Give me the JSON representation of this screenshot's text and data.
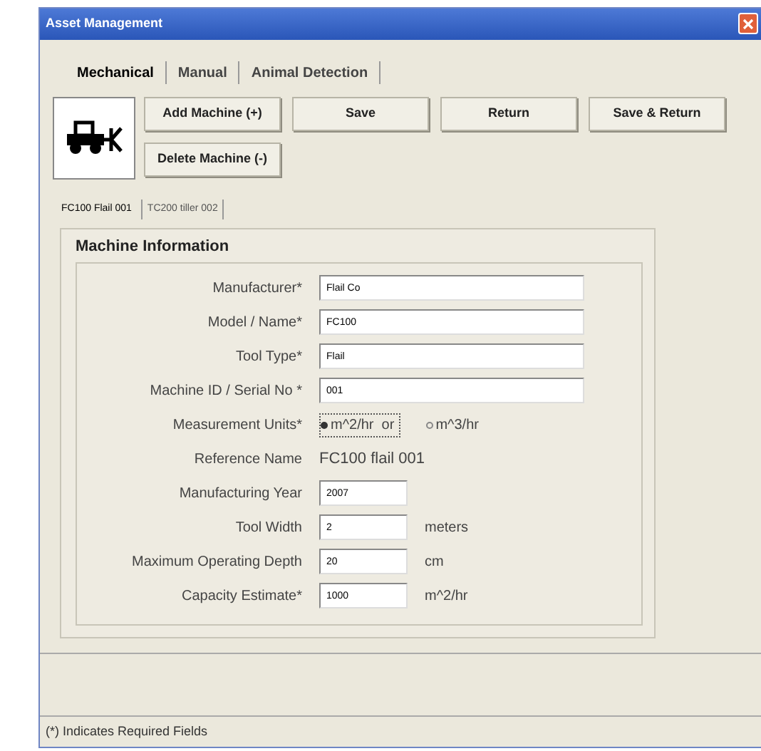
{
  "window": {
    "title": "Asset Management"
  },
  "tabs": [
    {
      "label": "Mechanical",
      "selected": true
    },
    {
      "label": "Manual",
      "selected": false
    },
    {
      "label": "Animal Detection",
      "selected": false
    }
  ],
  "buttons": [
    "Add Machine (+)",
    "Save",
    "Return",
    "Save & Return",
    "Delete Machine (-)"
  ],
  "machine_tabs": [
    {
      "label": "FC100 Flail 001",
      "selected": true
    },
    {
      "label": "TC200 tiller 002",
      "selected": false
    }
  ],
  "group": {
    "title": "Machine Information",
    "rows": [
      {
        "kind": "text",
        "label": "Manufacturer*",
        "value": "Flail Co"
      },
      {
        "kind": "text",
        "label": "Model / Name*",
        "value": "FC100"
      },
      {
        "kind": "text",
        "label": "Tool Type*",
        "value": "Flail"
      },
      {
        "kind": "text",
        "label": "Machine ID / Serial No *",
        "value": "001"
      },
      {
        "kind": "radio",
        "label": "Measurement Units*",
        "options": [
          {
            "label": "m^2/hr  or",
            "selected": true
          },
          {
            "label": "m^3/hr",
            "selected": false
          }
        ]
      },
      {
        "kind": "static",
        "label": "Reference Name",
        "value": "FC100 flail 001"
      },
      {
        "kind": "short",
        "label": "Manufacturing Year",
        "value": "2007"
      },
      {
        "kind": "short",
        "label": "Tool Width",
        "value": "2",
        "unit": "meters"
      },
      {
        "kind": "short",
        "label": "Maximum Operating Depth",
        "value": "20",
        "unit": "cm"
      },
      {
        "kind": "short",
        "label": "Capacity Estimate*",
        "value": "1000",
        "unit": "m^2/hr"
      }
    ]
  },
  "footer": "(*) Indicates Required Fields"
}
